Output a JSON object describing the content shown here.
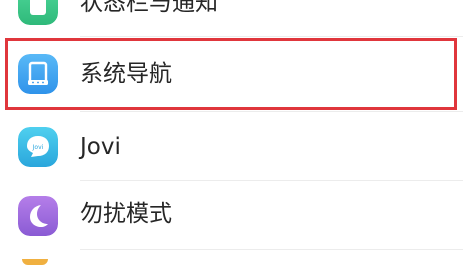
{
  "settings_list": {
    "items": [
      {
        "label": "状态栏与通知",
        "icon": "notification-bar-icon",
        "color": "#3ec98c"
      },
      {
        "label": "系统导航",
        "icon": "system-navigation-icon",
        "color": "#3fa9f5"
      },
      {
        "label": "Jovi",
        "icon": "jovi-icon",
        "icon_text": "Jovi",
        "color": "#39b8e6"
      },
      {
        "label": "勿扰模式",
        "icon": "do-not-disturb-moon-icon",
        "color": "#9b6bdb"
      }
    ],
    "highlighted_item": "系统导航",
    "highlight_color": "#e0363c"
  }
}
